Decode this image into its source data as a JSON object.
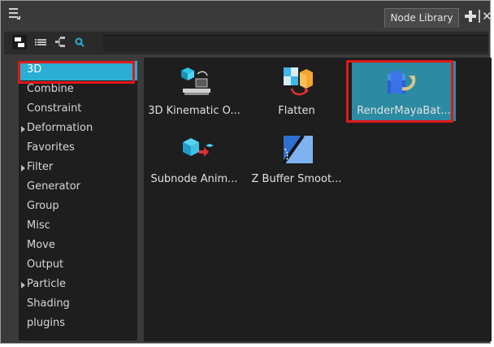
{
  "window": {
    "tab_label": "Node Library",
    "menu_icon": "hamburger-menu-icon",
    "add_icon": "plus-icon",
    "close_icon": "close-icon",
    "close_glyph": "✕"
  },
  "toolbar": {
    "buttons": [
      {
        "icon": "node-view-icon",
        "active": true
      },
      {
        "icon": "list-view-icon",
        "active": false
      },
      {
        "icon": "tree-view-icon",
        "active": false
      },
      {
        "icon": "search-icon",
        "active": false
      }
    ],
    "search_value": ""
  },
  "categories": [
    {
      "label": "3D",
      "selected": true,
      "expandable": false
    },
    {
      "label": "Combine",
      "selected": false,
      "expandable": false
    },
    {
      "label": "Constraint",
      "selected": false,
      "expandable": false
    },
    {
      "label": "Deformation",
      "selected": false,
      "expandable": true
    },
    {
      "label": "Favorites",
      "selected": false,
      "expandable": false
    },
    {
      "label": "Filter",
      "selected": false,
      "expandable": true
    },
    {
      "label": "Generator",
      "selected": false,
      "expandable": false
    },
    {
      "label": "Group",
      "selected": false,
      "expandable": false
    },
    {
      "label": "Misc",
      "selected": false,
      "expandable": false
    },
    {
      "label": "Move",
      "selected": false,
      "expandable": false
    },
    {
      "label": "Output",
      "selected": false,
      "expandable": false
    },
    {
      "label": "Particle",
      "selected": false,
      "expandable": true
    },
    {
      "label": "Shading",
      "selected": false,
      "expandable": false
    },
    {
      "label": "plugins",
      "selected": false,
      "expandable": false
    }
  ],
  "nodes": [
    {
      "label": "3D Kinematic O...",
      "icon": "kinematic-output-icon",
      "selected": false
    },
    {
      "label": "Flatten",
      "icon": "flatten-icon",
      "selected": false
    },
    {
      "label": "RenderMayaBat...",
      "icon": "render-maya-batch-icon",
      "selected": true
    },
    {
      "label": "Subnode Anim...",
      "icon": "subnode-animation-icon",
      "selected": false
    },
    {
      "label": "Z Buffer Smoot...",
      "icon": "z-buffer-smoothing-icon",
      "selected": false
    }
  ],
  "colors": {
    "selection_blue": "#2aaed3",
    "highlight_red": "#e01818"
  }
}
